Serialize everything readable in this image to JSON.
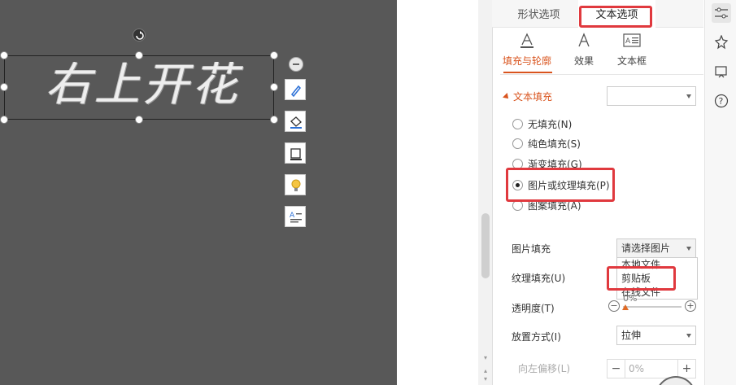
{
  "canvas": {
    "wordart_text": "右上开花"
  },
  "panel": {
    "tabs": [
      {
        "label": "形状选项"
      },
      {
        "label": "文本选项"
      }
    ],
    "subtabs": [
      {
        "label": "填充与轮廓",
        "icon": "text-fill-outline-icon"
      },
      {
        "label": "效果",
        "icon": "text-effect-icon"
      },
      {
        "label": "文本框",
        "icon": "textbox-icon"
      }
    ],
    "section": {
      "title": "文本填充",
      "color_value": ""
    },
    "fill_options": [
      {
        "label": "无填充(N)",
        "checked": false
      },
      {
        "label": "纯色填充(S)",
        "checked": false
      },
      {
        "label": "渐变填充(G)",
        "checked": false
      },
      {
        "label": "图片或纹理填充(P)",
        "checked": true
      },
      {
        "label": "图案填充(A)",
        "checked": false
      }
    ],
    "picture_fill": {
      "label": "图片填充",
      "value": "请选择图片",
      "options": [
        "本地文件",
        "剪贴板",
        "在线文件"
      ]
    },
    "texture_fill": {
      "label": "纹理填充(U)"
    },
    "opacity": {
      "label": "透明度(T)",
      "value": "0%",
      "minus": "−",
      "plus": "+"
    },
    "placement": {
      "label": "放置方式(I)",
      "value": "拉伸"
    },
    "offset_left": {
      "label": "向左偏移(L)",
      "value": "0%",
      "minus": "−",
      "plus": "+"
    }
  },
  "colors": {
    "accent": "#d9541e",
    "highlight": "#e0393e",
    "canvas_bg": "#585858"
  }
}
